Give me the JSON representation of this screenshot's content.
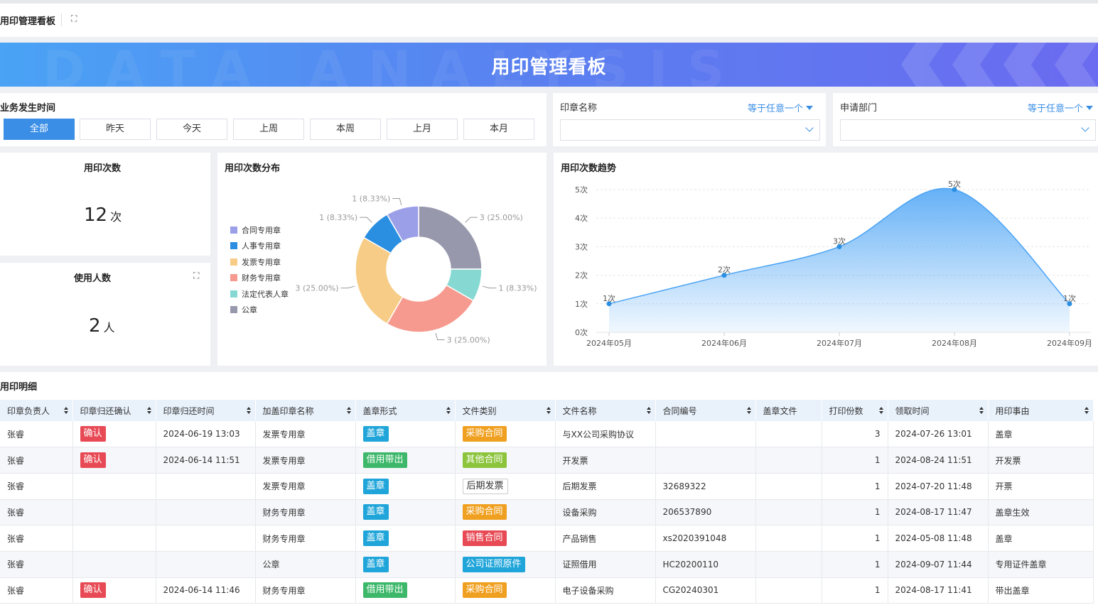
{
  "header": {
    "title": "用印管理看板"
  },
  "banner": {
    "title": "用印管理看板",
    "bg_text": "DATA ANALYSIS"
  },
  "time_filter": {
    "label": "业务发生时间",
    "buttons": [
      "全部",
      "昨天",
      "今天",
      "上周",
      "本周",
      "上月",
      "本月"
    ],
    "active": "全部"
  },
  "seal_filter": {
    "label": "印章名称",
    "operator": "等于任意一个",
    "value": ""
  },
  "dept_filter": {
    "label": "申请部门",
    "operator": "等于任意一个",
    "value": ""
  },
  "kpi_count": {
    "title": "用印次数",
    "value": "12",
    "unit": "次"
  },
  "kpi_users": {
    "title": "使用人数",
    "value": "2",
    "unit": "人"
  },
  "colors": {
    "accent": "#3a8ee6",
    "area": "#4aa3f5"
  },
  "pie_title": "用印次数分布",
  "trend_title": "用印次数趋势",
  "chart_data": [
    {
      "type": "pie",
      "title": "用印次数分布",
      "series": [
        {
          "name": "合同专用章",
          "value": 1,
          "label": "1 (8.33%)",
          "color": "#9b9fe8"
        },
        {
          "name": "人事专用章",
          "value": 1,
          "label": "1 (8.33%)",
          "color": "#2a8fe0"
        },
        {
          "name": "发票专用章",
          "value": 3,
          "label": "3 (25.00%)",
          "color": "#f7cc86"
        },
        {
          "name": "财务专用章",
          "value": 3,
          "label": "3 (25.00%)",
          "color": "#f69a8f"
        },
        {
          "name": "法定代表人章",
          "value": 1,
          "label": "1 (8.33%)",
          "color": "#86d9d2"
        },
        {
          "name": "公章",
          "value": 3,
          "label": "3 (25.00%)",
          "color": "#9898ad"
        }
      ]
    },
    {
      "type": "area",
      "title": "用印次数趋势",
      "x": [
        "2024年05月",
        "2024年06月",
        "2024年07月",
        "2024年08月",
        "2024年09月"
      ],
      "values": [
        1,
        2,
        3,
        5,
        1
      ],
      "point_labels": [
        "1次",
        "2次",
        "3次",
        "5次",
        "1次"
      ],
      "y_ticks": [
        "0次",
        "1次",
        "2次",
        "3次",
        "4次",
        "5次"
      ],
      "ylim": [
        0,
        5
      ]
    }
  ],
  "detail": {
    "title": "用印明细",
    "columns": [
      "印章负责人",
      "印章归还确认",
      "印章归还时间",
      "加盖印章名称",
      "盖章形式",
      "文件类别",
      "文件名称",
      "合同编号",
      "盖章文件",
      "打印份数",
      "领取时间",
      "用印事由"
    ],
    "rows": [
      {
        "owner": "张睿",
        "confirm": "确认",
        "return_time": "2024-06-19 13:03",
        "seal": "发票专用章",
        "form": "盖章",
        "category": "采购合同",
        "file": "与XX公司采购协议",
        "contract": "",
        "doc": "",
        "copies": "3",
        "pickup": "2024-07-26 13:01",
        "reason": "盖章"
      },
      {
        "owner": "张睿",
        "confirm": "确认",
        "return_time": "2024-06-14 11:51",
        "seal": "发票专用章",
        "form": "借用带出",
        "category": "其他合同",
        "file": "开发票",
        "contract": "",
        "doc": "",
        "copies": "1",
        "pickup": "2024-08-24 11:51",
        "reason": "开发票"
      },
      {
        "owner": "张睿",
        "confirm": "",
        "return_time": "",
        "seal": "发票专用章",
        "form": "盖章",
        "category": "后期发票",
        "file": "后期发票",
        "contract": "32689322",
        "doc": "",
        "copies": "1",
        "pickup": "2024-07-20 11:48",
        "reason": "开票"
      },
      {
        "owner": "张睿",
        "confirm": "",
        "return_time": "",
        "seal": "财务专用章",
        "form": "盖章",
        "category": "采购合同",
        "file": "设备采购",
        "contract": "206537890",
        "doc": "",
        "copies": "1",
        "pickup": "2024-08-17 11:47",
        "reason": "盖章生效"
      },
      {
        "owner": "张睿",
        "confirm": "",
        "return_time": "",
        "seal": "财务专用章",
        "form": "盖章",
        "category": "销售合同",
        "file": "产品销售",
        "contract": "xs2020391048",
        "doc": "",
        "copies": "1",
        "pickup": "2024-05-08 11:48",
        "reason": "盖章"
      },
      {
        "owner": "张睿",
        "confirm": "",
        "return_time": "",
        "seal": "公章",
        "form": "盖章",
        "category": "公司证照原件",
        "file": "证照借用",
        "contract": "HC20200110",
        "doc": "",
        "copies": "1",
        "pickup": "2024-09-07 11:44",
        "reason": "专用证件盖章"
      },
      {
        "owner": "张睿",
        "confirm": "确认",
        "return_time": "2024-06-14 11:46",
        "seal": "财务专用章",
        "form": "借用带出",
        "category": "采购合同",
        "file": "电子设备采购",
        "contract": "CG20240301",
        "doc": "",
        "copies": "1",
        "pickup": "2024-08-17 11:41",
        "reason": "带出盖章"
      }
    ],
    "tag_colors": {
      "confirm": "#e84a55",
      "盖章": "#1fa5d9",
      "借用带出": "#3db86a",
      "采购合同": "#f0a020",
      "其他合同": "#8cc43c",
      "销售合同": "#e84a55",
      "公司证照原件": "#1fa5d9"
    }
  }
}
